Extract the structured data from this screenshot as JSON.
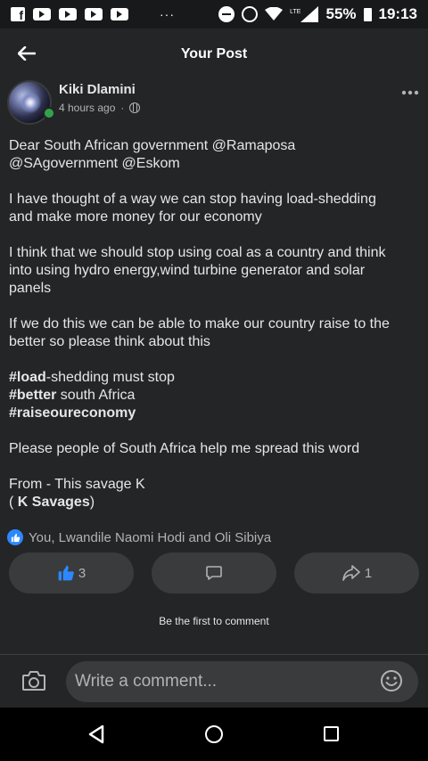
{
  "status_bar": {
    "battery": "55%",
    "time": "19:13",
    "network": "LTE",
    "more": "···"
  },
  "header": {
    "title": "Your Post"
  },
  "post": {
    "author": "Kiki Dlamini",
    "time": "4 hours ago",
    "separator": "·",
    "body": {
      "p1_l1": "Dear South African government @Ramaposa",
      "p1_l2": "@SAgovernment @Eskom",
      "p2_l1": "I have thought of a way we can stop having load-shedding",
      "p2_l2": "and make more money for our economy",
      "p3_l1": "I think that we should stop using coal as a country and think",
      "p3_l2": "into using hydro energy,wind turbine generator and solar",
      "p3_l3": "panels",
      "p4_l1": "If we do this we can be able to make our country raise to the",
      "p4_l2": "better so please think about this",
      "h1_tag": "#load",
      "h1_rest": "-shedding must stop",
      "h2_tag": "#better",
      "h2_rest": " south Africa",
      "h3_tag": "#raiseoureconomy",
      "p6": "Please people of South Africa help me spread this word",
      "p7_l1": "From - This savage K",
      "p7_l2_open": "( ",
      "p7_l2_bold": "K Savages",
      "p7_l2_close": ")"
    }
  },
  "reactions": {
    "summary": "You, Lwandile Naomi Hodi and Oli Sibiya"
  },
  "actions": {
    "like_count": "3",
    "share_count": "1"
  },
  "comments": {
    "empty_text": "Be the first to comment",
    "input_placeholder": "Write a comment..."
  },
  "colors": {
    "background": "#242526",
    "accent": "#2d88ff",
    "button": "#3a3b3c",
    "online": "#31a24c"
  }
}
